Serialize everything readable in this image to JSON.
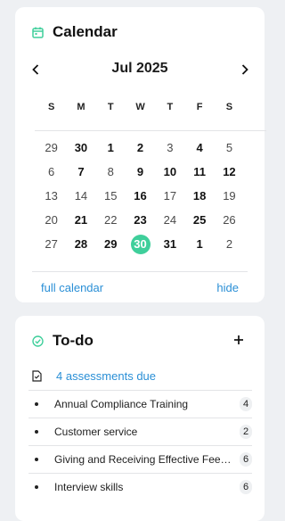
{
  "calendar": {
    "title": "Calendar",
    "month_label": "Jul 2025",
    "weekdays": [
      "S",
      "M",
      "T",
      "W",
      "T",
      "F",
      "S"
    ],
    "weeks": [
      [
        {
          "d": "29",
          "b": false
        },
        {
          "d": "30",
          "b": true
        },
        {
          "d": "1",
          "b": true
        },
        {
          "d": "2",
          "b": true
        },
        {
          "d": "3",
          "b": false
        },
        {
          "d": "4",
          "b": true
        },
        {
          "d": "5",
          "b": false
        }
      ],
      [
        {
          "d": "6",
          "b": false
        },
        {
          "d": "7",
          "b": true
        },
        {
          "d": "8",
          "b": false
        },
        {
          "d": "9",
          "b": true
        },
        {
          "d": "10",
          "b": true
        },
        {
          "d": "11",
          "b": true
        },
        {
          "d": "12",
          "b": true
        }
      ],
      [
        {
          "d": "13",
          "b": false
        },
        {
          "d": "14",
          "b": false
        },
        {
          "d": "15",
          "b": false
        },
        {
          "d": "16",
          "b": true
        },
        {
          "d": "17",
          "b": false
        },
        {
          "d": "18",
          "b": true
        },
        {
          "d": "19",
          "b": false
        }
      ],
      [
        {
          "d": "20",
          "b": false
        },
        {
          "d": "21",
          "b": true
        },
        {
          "d": "22",
          "b": false
        },
        {
          "d": "23",
          "b": true
        },
        {
          "d": "24",
          "b": false
        },
        {
          "d": "25",
          "b": true
        },
        {
          "d": "26",
          "b": false
        }
      ],
      [
        {
          "d": "27",
          "b": false
        },
        {
          "d": "28",
          "b": true
        },
        {
          "d": "29",
          "b": true
        },
        {
          "d": "30",
          "b": true,
          "today": true
        },
        {
          "d": "31",
          "b": true
        },
        {
          "d": "1",
          "b": true
        },
        {
          "d": "2",
          "b": false
        }
      ]
    ],
    "full_calendar_link": "full calendar",
    "hide_link": "hide"
  },
  "todo": {
    "title": "To-do",
    "assessments_link": "4 assessments due",
    "items": [
      {
        "label": "Annual Compliance Training",
        "count": "4"
      },
      {
        "label": "Customer service",
        "count": "2"
      },
      {
        "label": "Giving and Receiving Effective Feedback",
        "count": "6"
      },
      {
        "label": "Interview skills",
        "count": "6"
      }
    ]
  },
  "colors": {
    "accent": "#3fcf9b",
    "link": "#2a8fd6"
  }
}
